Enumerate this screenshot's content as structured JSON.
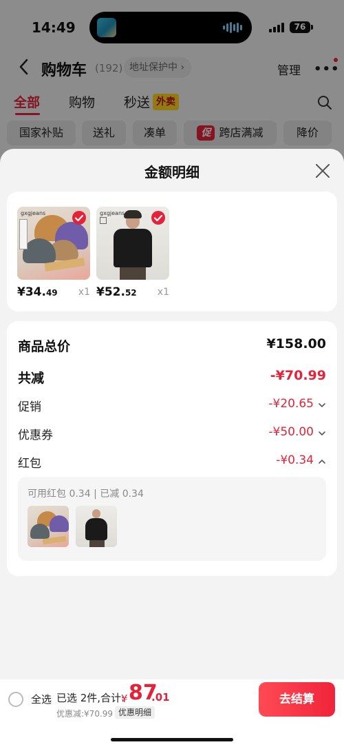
{
  "status": {
    "time": "14:49",
    "battery": "76"
  },
  "header": {
    "title": "购物车",
    "count": "(192)",
    "address_protect": "地址保护中",
    "manage": "管理"
  },
  "tabs": [
    {
      "label": "全部"
    },
    {
      "label": "购物"
    },
    {
      "label": "秒送"
    }
  ],
  "tab_badge": "外卖",
  "chips": [
    {
      "label": "国家补贴"
    },
    {
      "label": "送礼"
    },
    {
      "label": "凑单"
    },
    {
      "label": "跨店满减"
    },
    {
      "label": "降价"
    }
  ],
  "promo_badge": "促",
  "sheet": {
    "title": "金额明细",
    "products": [
      {
        "brand": "gxgjeans",
        "price_int": "¥34.",
        "price_dec": "49",
        "qty": "x1"
      },
      {
        "brand": "gxgjeans",
        "price_int": "¥52.",
        "price_dec": "52",
        "qty": "x1"
      }
    ],
    "summary": {
      "total_label": "商品总价",
      "total_value": "¥158.00",
      "reduce_label": "共减",
      "reduce_value": "-¥70.99",
      "promo_label": "促销",
      "promo_value": "-¥20.65",
      "coupon_label": "优惠券",
      "coupon_value": "-¥50.00",
      "redpack_label": "红包",
      "redpack_value": "-¥0.34",
      "redpack_detail": "可用红包 0.34 | 已减 0.34"
    }
  },
  "bottom": {
    "select_all": "全选",
    "selected_text": "已选 2件,合计:",
    "currency": "¥",
    "total_int": "87",
    "total_dec": ".01",
    "discount": "优惠减:¥70.99",
    "detail_button": "优惠明细",
    "checkout": "去结算"
  },
  "colors": {
    "accent": "#e4233a",
    "badge_yellow": "#ffd21f"
  }
}
